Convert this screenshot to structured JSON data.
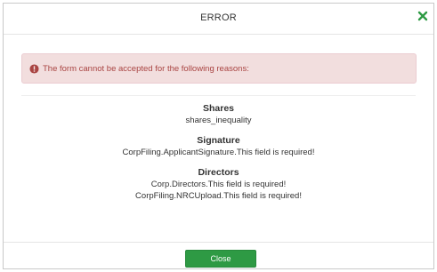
{
  "dialog": {
    "title": "ERROR",
    "close_icon": "close-x-icon",
    "accent_color": "#2e9a44"
  },
  "alert": {
    "icon": "exclamation-circle-icon",
    "message": "The form cannot be accepted for the following reasons:",
    "background_color": "#f2dede",
    "text_color": "#a94442"
  },
  "errors": [
    {
      "title": "Shares",
      "messages": [
        "shares_inequality"
      ]
    },
    {
      "title": "Signature",
      "messages": [
        "CorpFiling.ApplicantSignature.This field is required!"
      ]
    },
    {
      "title": "Directors",
      "messages": [
        "Corp.Directors.This field is required!",
        "CorpFiling.NRCUpload.This field is required!"
      ]
    }
  ],
  "footer": {
    "close_label": "Close"
  }
}
